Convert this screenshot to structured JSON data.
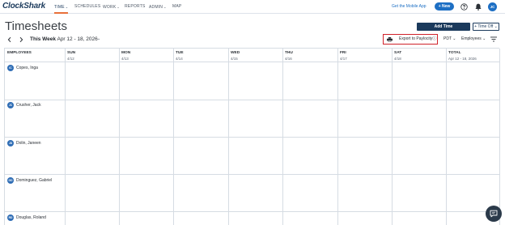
{
  "app": {
    "logo": "ClockShark"
  },
  "nav": {
    "items": [
      {
        "label": "TIME",
        "caret": "⌄",
        "active": true
      },
      {
        "label": "SCHEDULES",
        "caret": "",
        "active": false
      },
      {
        "label": "WORK",
        "caret": "⌄",
        "active": false
      },
      {
        "label": "REPORTS",
        "caret": "",
        "active": false
      },
      {
        "label": "ADMIN",
        "caret": "⌄",
        "active": false
      },
      {
        "label": "MAP",
        "caret": "",
        "active": false
      }
    ],
    "mobile_link": "Get the Mobile App",
    "new_button": "+ New",
    "user_initials": "JC"
  },
  "header": {
    "title": "Timesheets",
    "add_time": "Add Time",
    "time_off": "+ Time Off ⌄"
  },
  "week": {
    "range_bold": "This Week",
    "range": "Apr 12 - 18, 2026",
    "dropdown": "⌄",
    "export_label": "Export to Paylocity",
    "export_info": "ⓘ",
    "timezone": "PDT ⌄",
    "employees_filter": "Employees ⌄"
  },
  "table": {
    "columns": [
      {
        "label": "EMPLOYEES",
        "date": ""
      },
      {
        "label": "SUN",
        "date": "4/12"
      },
      {
        "label": "MON",
        "date": "4/13"
      },
      {
        "label": "TUE",
        "date": "4/14"
      },
      {
        "label": "WED",
        "date": "4/15"
      },
      {
        "label": "THU",
        "date": "4/16"
      },
      {
        "label": "FRI",
        "date": "4/17"
      },
      {
        "label": "SAT",
        "date": "4/18"
      },
      {
        "label": "TOTAL",
        "date": "Apr 12 - 18, 2026"
      }
    ],
    "employees": [
      {
        "initials": "IC",
        "name": "Copes, Inga"
      },
      {
        "initials": "JC",
        "name": "Crusher, Jack"
      },
      {
        "initials": "JD",
        "name": "Dolin, Janeen"
      },
      {
        "initials": "GD",
        "name": "Dominguez, Gabriel"
      },
      {
        "initials": "RD",
        "name": "Douglas, Roland"
      }
    ]
  },
  "colors": {
    "brand_navy": "#1b3a5c",
    "accent_blue": "#1d6fc4",
    "active_underline": "#e8703a",
    "highlight_red": "#d0222a"
  }
}
